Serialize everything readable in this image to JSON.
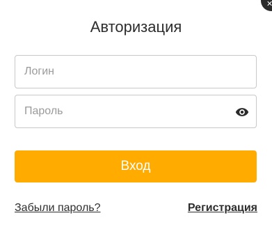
{
  "dialog": {
    "title": "Авторизация",
    "close_icon": "close-icon",
    "close_glyph": "✕"
  },
  "form": {
    "login_placeholder": "Логин",
    "login_value": "",
    "password_placeholder": "Пароль",
    "password_value": "",
    "password_toggle_icon": "eye-icon",
    "submit_label": "Вход"
  },
  "links": {
    "forgot_password": "Забыли пароль?",
    "register": "Регистрация"
  },
  "colors": {
    "accent": "#ffab00",
    "text": "#2d2d2d",
    "placeholder": "#9a9a9a",
    "border": "#c8c8c8",
    "close_button_bg": "#2b2b2b"
  }
}
